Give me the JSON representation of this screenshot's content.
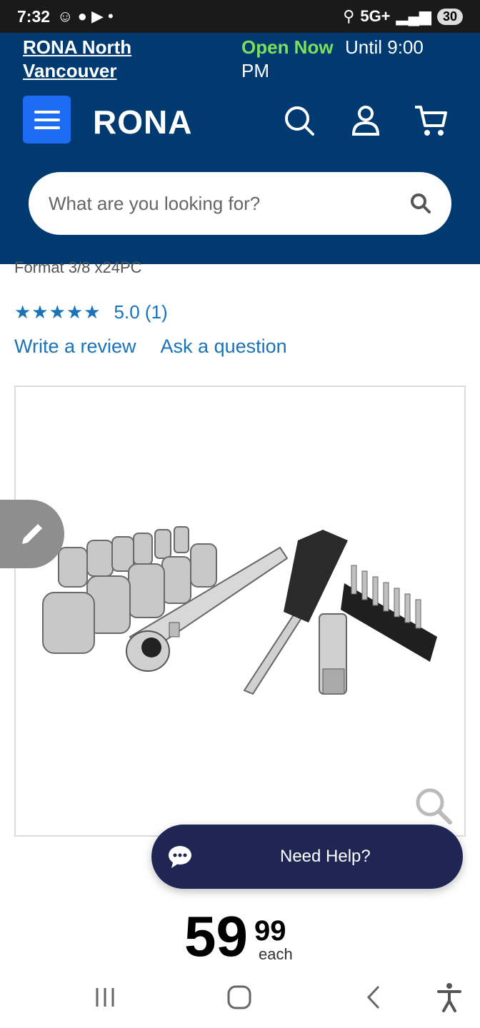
{
  "status": {
    "time": "7:32",
    "network": "5G+",
    "battery": "30"
  },
  "store": {
    "name": "RONA North Vancouver",
    "open_label": "Open Now",
    "hours": "Until 9:00 PM"
  },
  "header": {
    "logo": "RONA"
  },
  "search": {
    "placeholder": "What are you looking for?"
  },
  "product": {
    "format": "Format 3/8 x24PC",
    "stars": "★★★★★",
    "rating": "5.0 (1)",
    "write_review": "Write a review",
    "ask_question": "Ask a question"
  },
  "help": {
    "label": "Need Help?"
  },
  "price": {
    "dollars": "59",
    "cents": "99",
    "unit": "each"
  },
  "colors": {
    "brand": "#003a70",
    "accent": "#1d6cf5",
    "link": "#1a73b8",
    "help": "#1f2654",
    "open": "#7be05c"
  }
}
